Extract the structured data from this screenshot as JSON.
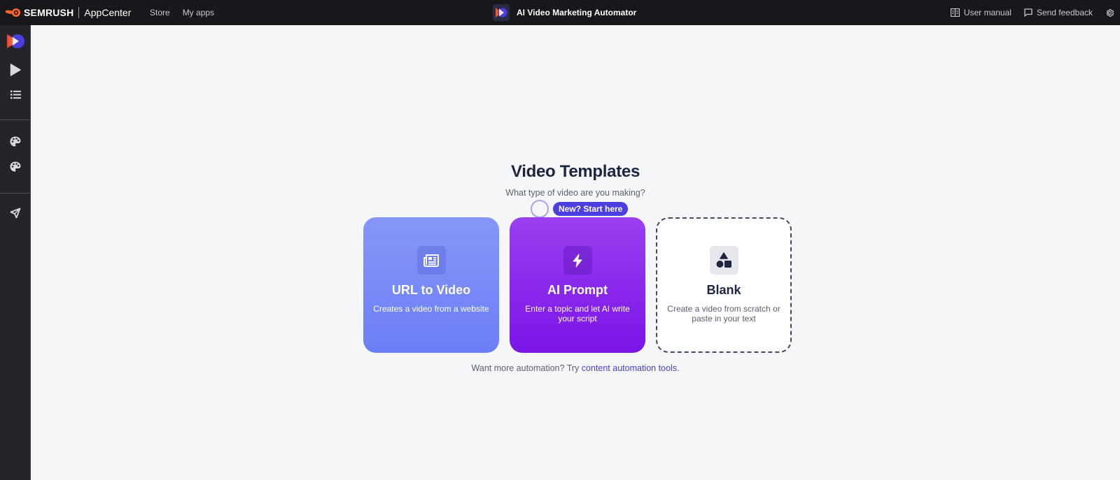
{
  "topbar": {
    "brand": "SEMRUSH",
    "product": "AppCenter",
    "nav": [
      {
        "label": "Store"
      },
      {
        "label": "My apps"
      }
    ],
    "app_title": "AI Video Marketing Automator",
    "right_links": [
      {
        "label": "User manual",
        "icon": "book-icon"
      },
      {
        "label": "Send feedback",
        "icon": "message-icon"
      }
    ],
    "settings_icon": "gear-icon"
  },
  "sidebar": {
    "items": [
      {
        "name": "app-logo",
        "icon": "app-logo-icon"
      },
      {
        "name": "play",
        "icon": "play-icon"
      },
      {
        "name": "list",
        "icon": "list-icon"
      },
      {
        "name": "palette-1",
        "icon": "palette-icon"
      },
      {
        "name": "palette-2",
        "icon": "palette-icon"
      },
      {
        "name": "send",
        "icon": "send-icon"
      }
    ]
  },
  "main": {
    "title": "Video Templates",
    "subtitle": "What type of video are you making?",
    "onboarding_pill": "New? Start here",
    "cards": [
      {
        "title": "URL to Video",
        "description": "Creates a video from a website",
        "icon": "newspaper-icon"
      },
      {
        "title": "AI Prompt",
        "description": "Enter a topic and let AI write your script",
        "icon": "lightning-icon"
      },
      {
        "title": "Blank",
        "description": "Create a video from scratch or paste in your text",
        "icon": "shapes-icon"
      }
    ],
    "footer_text": "Want more automation? Try ",
    "footer_link": "content automation tools",
    "footer_end": "."
  },
  "colors": {
    "topbar_bg": "#17181c",
    "sidebar_bg": "#23252b",
    "page_bg": "#f5f6f8",
    "url_card": "#7a8cf6",
    "ai_card": "#8a28ec",
    "accent": "#4b3fe0",
    "heading": "#1c2541"
  }
}
